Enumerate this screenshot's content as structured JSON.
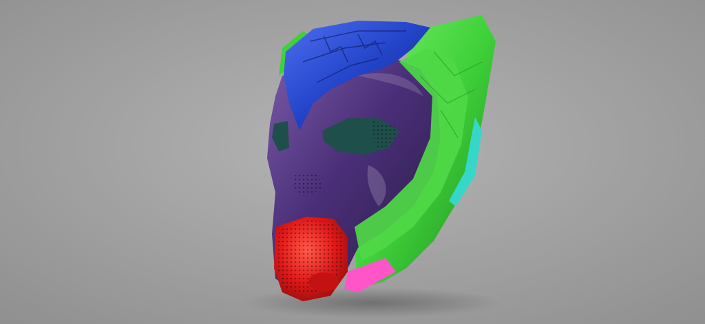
{
  "scene": {
    "subject": "helmet-render",
    "background": {
      "center": "#b4b4b4",
      "edge": "#8f8f8f"
    },
    "parts": {
      "face_shell": {
        "base": "#4a2f78",
        "light": "#7b5aa8",
        "dark": "#2a1a45"
      },
      "crown": {
        "base": "#2243c8",
        "light": "#4d6ef0",
        "dark": "#14287a"
      },
      "ear_panel": {
        "base": "#3fd13a",
        "light": "#7aef6b",
        "dark": "#1f8a1d"
      },
      "mouth_grill": {
        "base": "#e01818",
        "light": "#ff5a4a",
        "dark": "#8a0c0c"
      },
      "neck_trim_cyan": {
        "base": "#35d8c8"
      },
      "neck_trim_pink": {
        "base": "#ff55c8"
      },
      "eye_lens": {
        "base": "#1f4f4a"
      }
    }
  }
}
